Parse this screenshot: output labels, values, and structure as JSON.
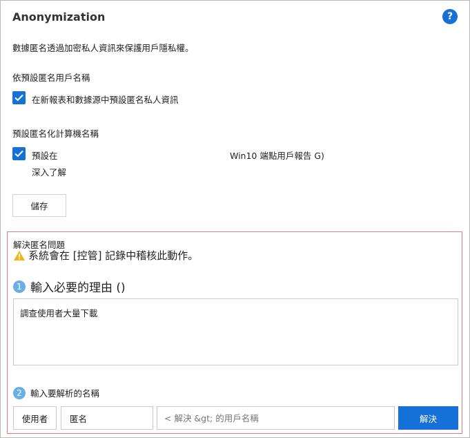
{
  "header": {
    "title": "Anonymization",
    "help_glyph": "?"
  },
  "description": "數據匿名透過加密私人資訊來保護用戶隱私權。",
  "username_section": {
    "label": "依預設匿名用戶名稱",
    "checkbox_label": "在新報表和數據源中預設匿名私人資訊",
    "checked": true
  },
  "device_section": {
    "label": "預設匿名化計算機名稱",
    "checkbox_label": "預設在",
    "extra_text": "Win10 端點用戶報告 G)",
    "learn_more": "深入了解",
    "checked": true
  },
  "save_label": "儲存",
  "resolve": {
    "heading": "解決匿名問題",
    "warning": "系統會在 [控管] 記錄中稽核此動作。",
    "step1": {
      "number": "1",
      "label": "輸入必要的理由 ()"
    },
    "reason_value": "調查使用者大量下載",
    "step2": {
      "number": "2",
      "label": "輸入要解析的名稱"
    },
    "user_button": "使用者",
    "anon_value": "匿名",
    "name_placeholder": "< 解決 &gt; 的用戶名稱",
    "resolve_button": "解決"
  },
  "colors": {
    "accent": "#1570d8",
    "highlight_border": "#e07b80",
    "step_badge": "#6aaee8",
    "warning": "#f2b418"
  }
}
